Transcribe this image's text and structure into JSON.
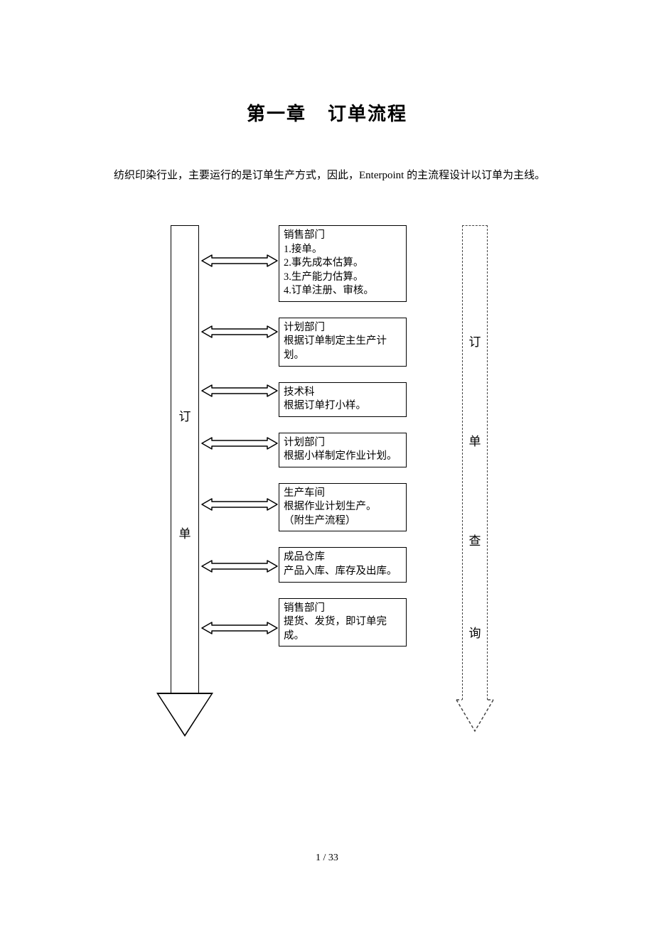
{
  "title_a": "第一章",
  "title_b": "订单流程",
  "intro": "纺织印染行业，主要运行的是订单生产方式，因此，Enterpoint 的主流程设计以订单为主线。",
  "left_arrow_label_1": "订",
  "left_arrow_label_2": "单",
  "right_arrow": {
    "c1": "订",
    "c2": "单",
    "c3": "查",
    "c4": "询"
  },
  "boxes": [
    {
      "dept": "销售部门",
      "body": "1.接单。\n2.事先成本估算。\n3.生产能力估算。\n4.订单注册、审核。"
    },
    {
      "dept": "计划部门",
      "body": "根据订单制定主生产计划。"
    },
    {
      "dept": "技术科",
      "body": "根据订单打小样。"
    },
    {
      "dept": "计划部门",
      "body": "根据小样制定作业计划。"
    },
    {
      "dept": "生产车间",
      "body": "根据作业计划生产。\n（附生产流程）"
    },
    {
      "dept": "成品仓库",
      "body": "产品入库、库存及出库。"
    },
    {
      "dept": "销售部门",
      "body": "提货、发货，即订单完成。"
    }
  ],
  "conn_tops": [
    40,
    140,
    223,
    297,
    383,
    470,
    557
  ],
  "page_number": "1  / 33"
}
